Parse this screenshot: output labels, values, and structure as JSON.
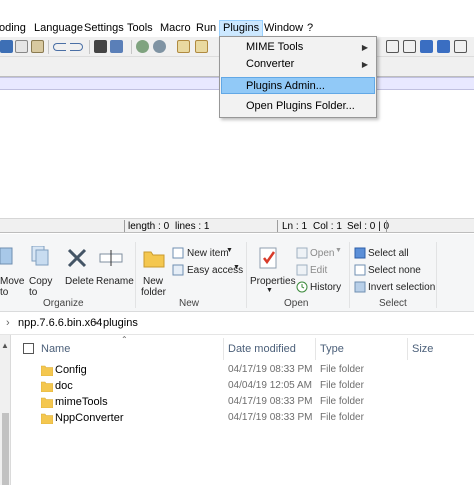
{
  "npp": {
    "menu": [
      "oding",
      "Language",
      "Settings",
      "Tools",
      "Macro",
      "Run",
      "Plugins",
      "Window",
      "?"
    ],
    "active_menu": "Plugins",
    "plugins_menu": {
      "items": [
        {
          "label": "MIME Tools",
          "has_submenu": true
        },
        {
          "label": "Converter",
          "has_submenu": true
        },
        {
          "label": "Plugins Admin...",
          "has_submenu": false,
          "highlighted": true
        },
        {
          "label": "Open Plugins Folder...",
          "has_submenu": false
        }
      ]
    },
    "status": {
      "length": "length : 0",
      "lines": "lines : 1",
      "ln": "Ln : 1",
      "col": "Col : 1",
      "sel": "Sel : 0 | 0"
    },
    "colors": {
      "menu_active_bg": "#cce8ff",
      "dropdown_highlight": "#91c9f7",
      "current_line": "#e8e8ff"
    }
  },
  "explorer": {
    "ribbon": {
      "organize": {
        "move_to": [
          "Move",
          "to"
        ],
        "copy_to": [
          "Copy",
          "to"
        ],
        "delete": "Delete",
        "rename": "Rename",
        "group_label": "Organize"
      },
      "new": {
        "new_folder": [
          "New",
          "folder"
        ],
        "new_item": "New item",
        "easy_access": "Easy access",
        "group_label": "New"
      },
      "open": {
        "properties": "Properties",
        "open": "Open",
        "edit": "Edit",
        "history": "History",
        "group_label": "Open"
      },
      "select": {
        "select_all": "Select all",
        "select_none": "Select none",
        "invert_selection": "Invert selection",
        "group_label": "Select"
      }
    },
    "address": {
      "segments": [
        "npp.7.6.6.bin.x64",
        "plugins"
      ]
    },
    "columns": [
      "Name",
      "Date modified",
      "Type",
      "Size"
    ],
    "files": [
      {
        "name": "Config",
        "date": "04/17/19 08:33 PM",
        "type": "File folder"
      },
      {
        "name": "doc",
        "date": "04/04/19 12:05 AM",
        "type": "File folder"
      },
      {
        "name": "mimeTools",
        "date": "04/17/19 08:33 PM",
        "type": "File folder"
      },
      {
        "name": "NppConverter",
        "date": "04/17/19 08:33 PM",
        "type": "File folder"
      }
    ],
    "colors": {
      "folder": "#f4c74f",
      "header_text": "#4c607a"
    }
  }
}
